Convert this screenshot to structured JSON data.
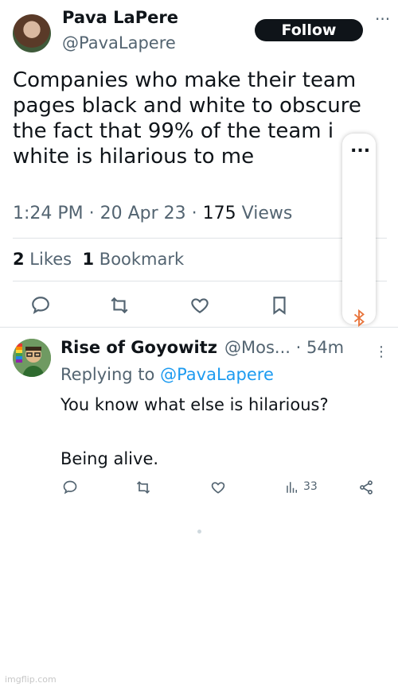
{
  "tweet": {
    "author_name": "Pava LaPere",
    "author_handle": "@PavaLapere",
    "follow_label": "Follow",
    "more_label": "···",
    "text_lines": [
      "Companies who make their team",
      "pages black and white to obscure",
      "the fact that 99% of the team i",
      "white is hilarious to me"
    ],
    "time_date": "1:24 PM · 20 Apr 23 · ",
    "views_count": "175",
    "views_label": " Views",
    "likes_count": "2",
    "likes_label": " Likes",
    "bookmarks_count": "1",
    "bookmarks_label": "Bookmark"
  },
  "overlay": {
    "dots": "..."
  },
  "reply": {
    "author_name": "Rise of Goyowitz",
    "author_handle_time": "@Mos... · 54m",
    "more_label": "⋮",
    "replying_prefix": "Replying to ",
    "replying_handle": "@PavaLapere",
    "text_lines": [
      "You know what else is hilarious?",
      "",
      "Being alive."
    ],
    "views_count": "33"
  },
  "watermark": "imgflip.com",
  "icons": {
    "reply": "reply-icon",
    "retweet": "retweet-icon",
    "like": "heart-icon",
    "bookmark": "bookmark-icon",
    "bluetooth": "bluetooth-icon",
    "views": "views-icon",
    "share": "share-icon"
  },
  "colors": {
    "text_primary": "#0f1419",
    "text_secondary": "#536471",
    "link": "#1d9bf0",
    "bluetooth": "#e8743b"
  }
}
